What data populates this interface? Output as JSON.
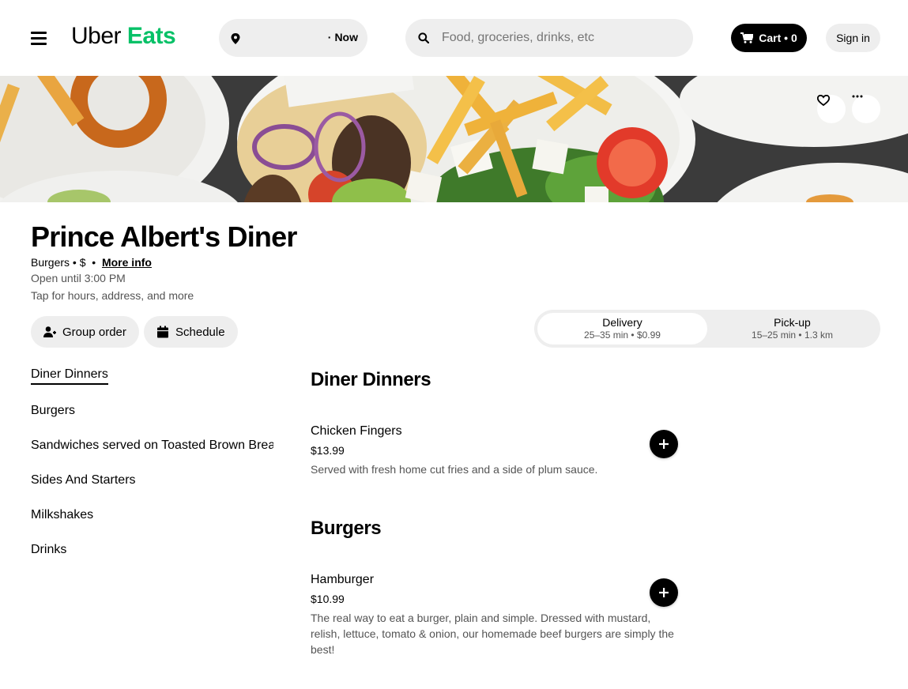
{
  "header": {
    "logo_part1": "Uber",
    "logo_part2": "Eats",
    "location_now": "Now",
    "search_placeholder": "Food, groceries, drinks, etc",
    "cart_label": "Cart • 0",
    "signin_label": "Sign in"
  },
  "restaurant": {
    "name": "Prince Albert's Diner",
    "cuisine": "Burgers • $",
    "more_info": "More info",
    "hours": "Open until 3:00 PM",
    "tap_hint": "Tap for hours, address, and more",
    "group_order": "Group order",
    "schedule": "Schedule"
  },
  "fulfillment": {
    "delivery_label": "Delivery",
    "delivery_sub": "25–35 min • $0.99",
    "pickup_label": "Pick-up",
    "pickup_sub": "15–25 min • 1.3 km"
  },
  "sidebar": {
    "items": [
      {
        "label": "Diner Dinners"
      },
      {
        "label": "Burgers"
      },
      {
        "label": "Sandwiches served on Toasted Brown Bread"
      },
      {
        "label": "Sides And Starters"
      },
      {
        "label": "Milkshakes"
      },
      {
        "label": "Drinks"
      }
    ]
  },
  "menu": {
    "sections": [
      {
        "title": "Diner Dinners",
        "items": [
          {
            "name": "Chicken Fingers",
            "price": "$13.99",
            "description": "Served with fresh home cut fries and a side of plum sauce."
          }
        ]
      },
      {
        "title": "Burgers",
        "items": [
          {
            "name": "Hamburger",
            "price": "$10.99",
            "description": "The real way to eat a burger, plain and simple. Dressed with mustard, relish, lettuce, tomato & onion, our homemade beef burgers are simply the best!"
          }
        ]
      }
    ]
  },
  "icons": {
    "menu": "hamburger-menu-icon",
    "location": "location-pin-icon",
    "search": "search-icon",
    "cart": "cart-icon",
    "favorite": "heart-icon",
    "more": "more-options-icon",
    "group": "add-person-icon",
    "schedule": "calendar-icon",
    "add": "plus-icon"
  },
  "colors": {
    "brand_green": "#06c167",
    "pill_gray": "#eeeeee",
    "secondary_text": "#545454"
  }
}
